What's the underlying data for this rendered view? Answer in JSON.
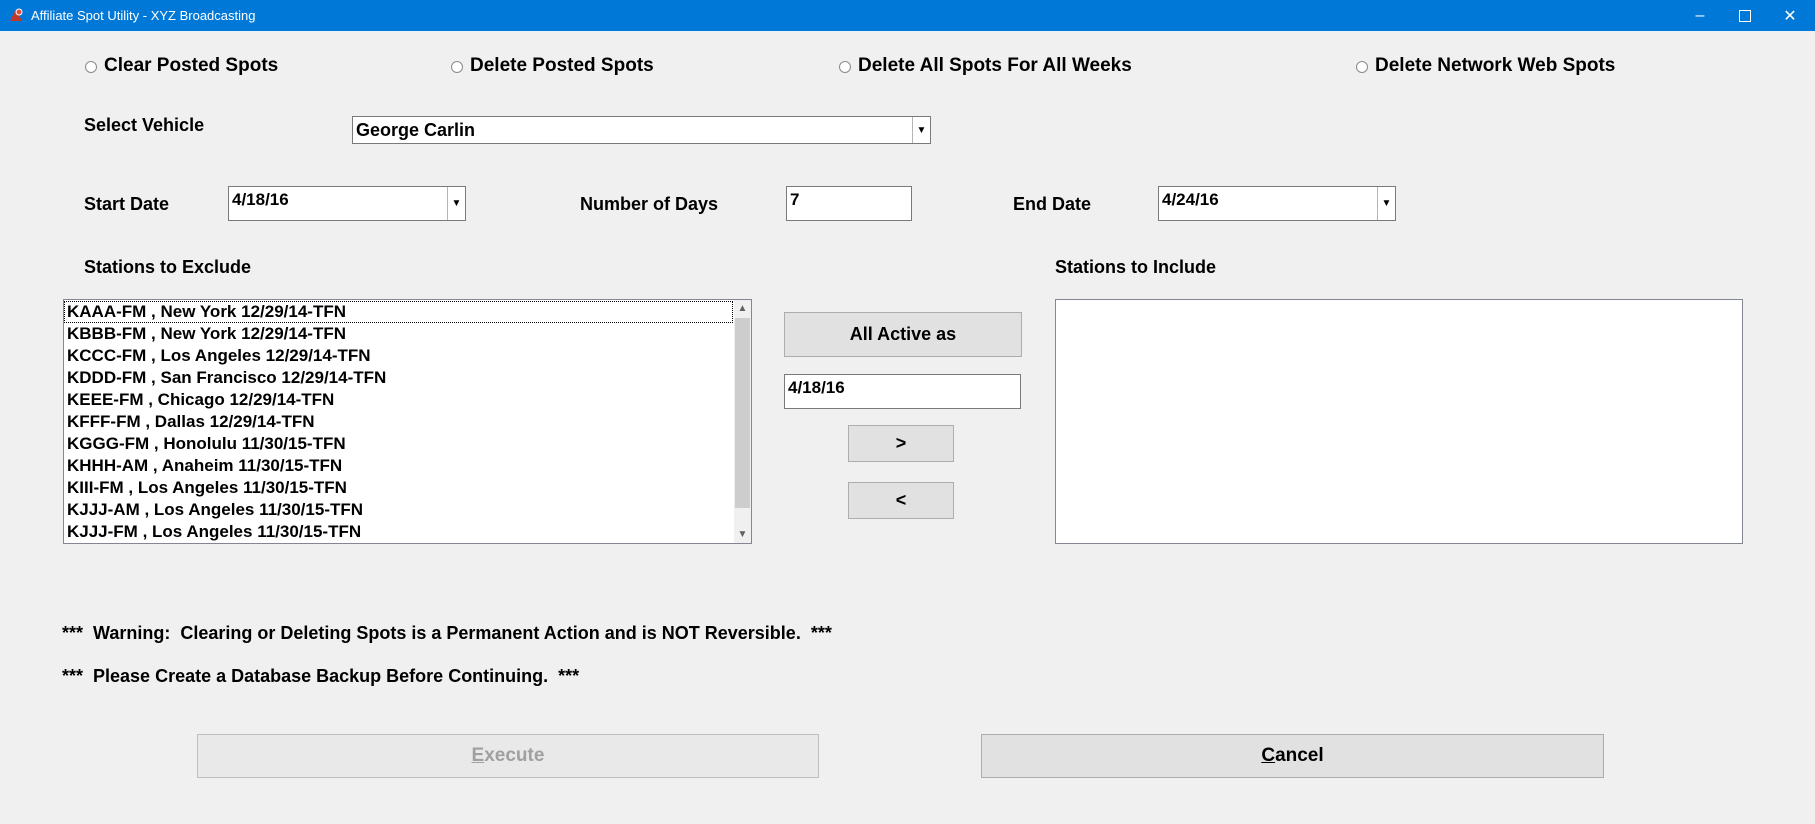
{
  "window": {
    "title": "Affiliate Spot Utility - XYZ Broadcasting",
    "minimize_icon": "minimize-icon",
    "maximize_icon": "maximize-icon",
    "close_icon": "close-icon",
    "accent": "#0078d7"
  },
  "options": [
    {
      "label": "Clear Posted Spots",
      "selected": false
    },
    {
      "label": "Delete Posted Spots",
      "selected": false
    },
    {
      "label": "Delete All Spots For All Weeks",
      "selected": false
    },
    {
      "label": "Delete Network Web Spots",
      "selected": false
    }
  ],
  "vehicle": {
    "label": "Select Vehicle",
    "value": "George Carlin"
  },
  "dates": {
    "start_label": "Start Date",
    "start_value": "4/18/16",
    "days_label": "Number of Days",
    "days_value": "7",
    "end_label": "End Date",
    "end_value": "4/24/16"
  },
  "exclude": {
    "label": "Stations to Exclude",
    "items": [
      "KAAA-FM , New York 12/29/14-TFN",
      "KBBB-FM , New York 12/29/14-TFN",
      "KCCC-FM , Los Angeles 12/29/14-TFN",
      "KDDD-FM , San Francisco 12/29/14-TFN",
      "KEEE-FM , Chicago 12/29/14-TFN",
      "KFFF-FM , Dallas 12/29/14-TFN",
      "KGGG-FM , Honolulu 11/30/15-TFN",
      "KHHH-AM , Anaheim 11/30/15-TFN",
      "KIII-FM , Los Angeles 11/30/15-TFN",
      "KJJJ-AM , Los Angeles 11/30/15-TFN",
      "KJJJ-FM , Los Angeles 11/30/15-TFN"
    ]
  },
  "transfer": {
    "all_active_label": "All Active as",
    "active_date": "4/18/16",
    "move_right": ">",
    "move_left": "<"
  },
  "include": {
    "label": "Stations to Include",
    "items": []
  },
  "warnings": {
    "line1": "***  Warning:  Clearing or Deleting Spots is a Permanent Action and is NOT Reversible.  ***",
    "line2": "***  Please Create a Database Backup Before Continuing.  ***"
  },
  "actions": {
    "execute_mnemonic": "E",
    "execute_rest": "xecute",
    "cancel_mnemonic": "C",
    "cancel_rest": "ancel"
  }
}
